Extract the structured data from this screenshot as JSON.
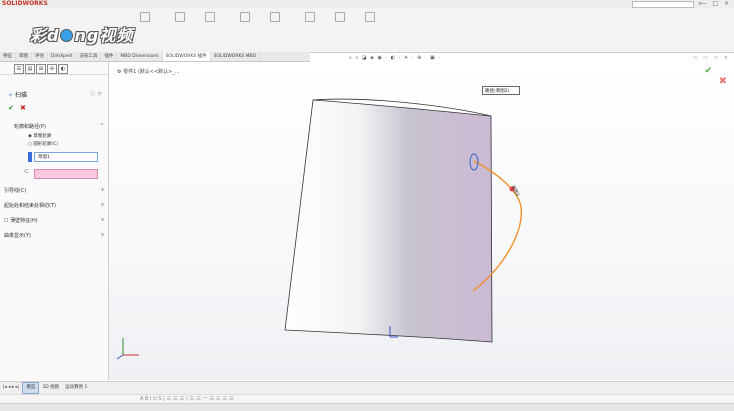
{
  "app": {
    "brand": "SOLIDWORKS",
    "search_placeholder": "",
    "window_controls": "— □ ×"
  },
  "logo": {
    "pre": "彩",
    "mid": "ng",
    "post": "视频",
    "letter": "d"
  },
  "ribbon_buttons": [
    "",
    "",
    "",
    "",
    "",
    "",
    "",
    "",
    ""
  ],
  "command_tabs": [
    {
      "label": "特征",
      "active": false
    },
    {
      "label": "草图",
      "active": false
    },
    {
      "label": "评估",
      "active": false
    },
    {
      "label": "DimXpert",
      "active": false
    },
    {
      "label": "渲染工具",
      "active": false
    },
    {
      "label": "插件",
      "active": false
    },
    {
      "label": "MBD Dimensions",
      "active": false
    },
    {
      "label": "SOLIDWORKS 插件",
      "active": true
    },
    {
      "label": "SOLIDWORKS MBD",
      "active": false
    }
  ],
  "pm": {
    "title": "扫描",
    "icon_tabs": [
      "☰",
      "▤",
      "⊞",
      "✣",
      "◐"
    ],
    "group_profile": "轮廓和路径(P)",
    "radio_sketch": "草图轮廓",
    "radio_circle": "圆形轮廓(C)",
    "profile_value": "草图1",
    "path_value": "",
    "group_options": "引导线(C)",
    "group_start_end": "起始处和结束处相切(T)",
    "group_thin": "薄壁特征(H)",
    "group_curvature": "曲率显示(Y)"
  },
  "viewport": {
    "breadcrumb": "零件1 (默认<<默认>_...",
    "tag_label": "路径(草图2)",
    "sketch_label": "草图3"
  },
  "bottom_tabs": [
    {
      "label": "模型",
      "active": true
    },
    {
      "label": "3D 视图",
      "active": false
    },
    {
      "label": "运动算例 1",
      "active": false
    }
  ],
  "status": {
    "left": "",
    "format_bar": "A B I U S | 三 三 三 | 三 三 一 三 三 三 三"
  },
  "colors": {
    "path_curve": "#f0922b",
    "body_fill_dark": "#c9bfd2",
    "accent": "#3b6fd8"
  }
}
